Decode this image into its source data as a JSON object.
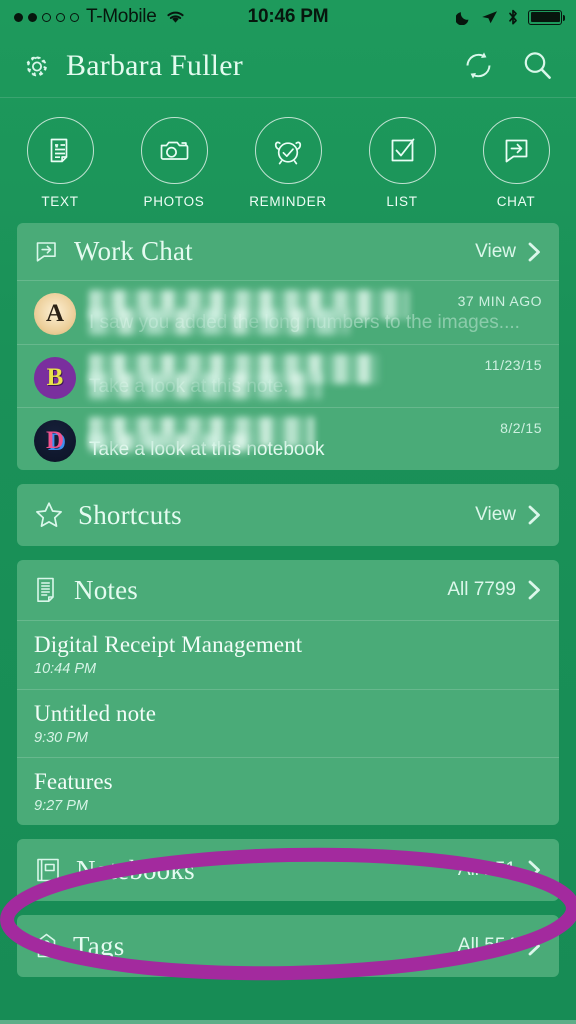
{
  "status_bar": {
    "signal_dots_filled": 2,
    "signal_dots_total": 5,
    "carrier": "T-Mobile",
    "wifi_icon": "wifi-icon",
    "time": "10:46 PM",
    "dnd_icon": "moon-icon",
    "location_icon": "location-arrow-icon",
    "bluetooth_icon": "bluetooth-icon",
    "battery_icon": "battery-full-icon",
    "battery_level": "100"
  },
  "header": {
    "gear_icon": "gear-icon",
    "username": "Barbara Fuller",
    "sync_icon": "sync-icon",
    "search_icon": "search-icon"
  },
  "quick_actions": [
    {
      "label": "TEXT",
      "icon": "text-document-icon"
    },
    {
      "label": "PHOTOS",
      "icon": "camera-icon"
    },
    {
      "label": "REMINDER",
      "icon": "alarm-clock-icon"
    },
    {
      "label": "LIST",
      "icon": "checkbox-icon"
    },
    {
      "label": "CHAT",
      "icon": "chat-bubble-arrow-icon"
    }
  ],
  "work_chat": {
    "title": "Work Chat",
    "icon": "chat-bubble-arrow-icon",
    "action_label": "View",
    "chevron_icon": "chevron-right-icon",
    "messages": [
      {
        "avatar_letter": "A",
        "sender": "",
        "sender_redacted": true,
        "time": "37 MIN AGO",
        "preview": "I saw you added the long numbers to the images...."
      },
      {
        "avatar_letter": "B",
        "sender": "",
        "sender_redacted": true,
        "time": "11/23/15",
        "preview": "Take a look at this note."
      },
      {
        "avatar_letter": "D",
        "sender": "",
        "sender_redacted": true,
        "time": "8/2/15",
        "preview": "Take a look at this notebook"
      }
    ]
  },
  "shortcuts": {
    "title": "Shortcuts",
    "icon": "star-icon",
    "action_label": "View",
    "chevron_icon": "chevron-right-icon"
  },
  "notes": {
    "title": "Notes",
    "icon": "note-document-icon",
    "action_label": "All 7799",
    "chevron_icon": "chevron-right-icon",
    "items": [
      {
        "title": "Digital Receipt Management",
        "time": "10:44 PM"
      },
      {
        "title": "Untitled note",
        "time": "9:30 PM"
      },
      {
        "title": "Features",
        "time": "9:27 PM"
      }
    ]
  },
  "notebooks": {
    "title": "Notebooks",
    "icon": "notebook-icon",
    "action_label": "All 251",
    "chevron_icon": "chevron-right-icon",
    "highlighted": true
  },
  "tags": {
    "title": "Tags",
    "icon": "tag-icon",
    "action_label": "All 554",
    "chevron_icon": "chevron-right-icon"
  },
  "annotation": {
    "shape": "ellipse",
    "target": "notebooks-row",
    "color": "#A32A9E",
    "stroke_width": 14
  },
  "colors": {
    "background_green": "#1a9158",
    "card_green": "#4aab78",
    "text_light": "#e4fbf0",
    "annotation_magenta": "#A32A9E"
  }
}
